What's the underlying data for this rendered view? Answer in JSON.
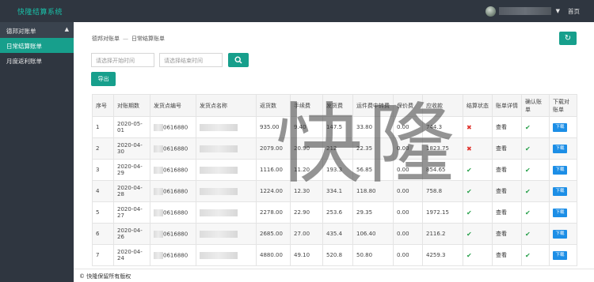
{
  "header": {
    "brand": "快隆结算系统",
    "home": "首页"
  },
  "sidebar": {
    "group": "德邦对账单",
    "items": [
      {
        "label": "日常结算账单",
        "active": true
      },
      {
        "label": "月度返利账单",
        "active": false
      }
    ]
  },
  "breadcrumb": {
    "parent": "德邦对账单",
    "separator": "—",
    "current": "日常结算账单"
  },
  "filters": {
    "start_placeholder": "请选择开始时间",
    "end_placeholder": "请选择结束时间"
  },
  "export_label": "导出",
  "table": {
    "headers": [
      "序号",
      "对账期数",
      "发货点编号",
      "发货点名称",
      "返货数",
      "手续费",
      "发货费",
      "运件费中转费",
      "保价费",
      "应收款",
      "结算状态",
      "账单详情",
      "确认账单",
      "下载对账单"
    ],
    "rows": [
      {
        "no": "1",
        "period": "2020-05-01",
        "code": "0616880",
        "count": "935.00",
        "fee": "9.40",
        "ship": "147.5",
        "transfer": "33.80",
        "insured": "0.00",
        "receivable": "744.3",
        "status": "cross",
        "detail": "查看",
        "confirm": "check",
        "download": "下载"
      },
      {
        "no": "2",
        "period": "2020-04-30",
        "code": "0616880",
        "count": "2079.00",
        "fee": "20.90",
        "ship": "212",
        "transfer": "22.35",
        "insured": "0.00",
        "receivable": "1823.75",
        "status": "cross",
        "detail": "查看",
        "confirm": "check",
        "download": "下载"
      },
      {
        "no": "3",
        "period": "2020-04-29",
        "code": "0616880",
        "count": "1116.00",
        "fee": "11.20",
        "ship": "193.3",
        "transfer": "56.85",
        "insured": "0.00",
        "receivable": "854.65",
        "status": "check",
        "detail": "查看",
        "confirm": "check",
        "download": "下载"
      },
      {
        "no": "4",
        "period": "2020-04-28",
        "code": "0616880",
        "count": "1224.00",
        "fee": "12.30",
        "ship": "334.1",
        "transfer": "118.80",
        "insured": "0.00",
        "receivable": "758.8",
        "status": "check",
        "detail": "查看",
        "confirm": "check",
        "download": "下载"
      },
      {
        "no": "5",
        "period": "2020-04-27",
        "code": "0616880",
        "count": "2278.00",
        "fee": "22.90",
        "ship": "253.6",
        "transfer": "29.35",
        "insured": "0.00",
        "receivable": "1972.15",
        "status": "check",
        "detail": "查看",
        "confirm": "check",
        "download": "下载"
      },
      {
        "no": "6",
        "period": "2020-04-26",
        "code": "0616880",
        "count": "2685.00",
        "fee": "27.00",
        "ship": "435.4",
        "transfer": "106.40",
        "insured": "0.00",
        "receivable": "2116.2",
        "status": "check",
        "detail": "查看",
        "confirm": "check",
        "download": "下载"
      },
      {
        "no": "7",
        "period": "2020-04-24",
        "code": "0616880",
        "count": "4880.00",
        "fee": "49.10",
        "ship": "520.8",
        "transfer": "50.80",
        "insured": "0.00",
        "receivable": "4259.3",
        "status": "check",
        "detail": "查看",
        "confirm": "check",
        "download": "下载"
      }
    ]
  },
  "footer": "© 快隆保留所有版权",
  "watermark": "快隆",
  "colors": {
    "topbar": "#2f3640",
    "accent": "#179f8c",
    "download": "#1c8ee6",
    "cross": "#e0322c",
    "check": "#27a04a"
  }
}
